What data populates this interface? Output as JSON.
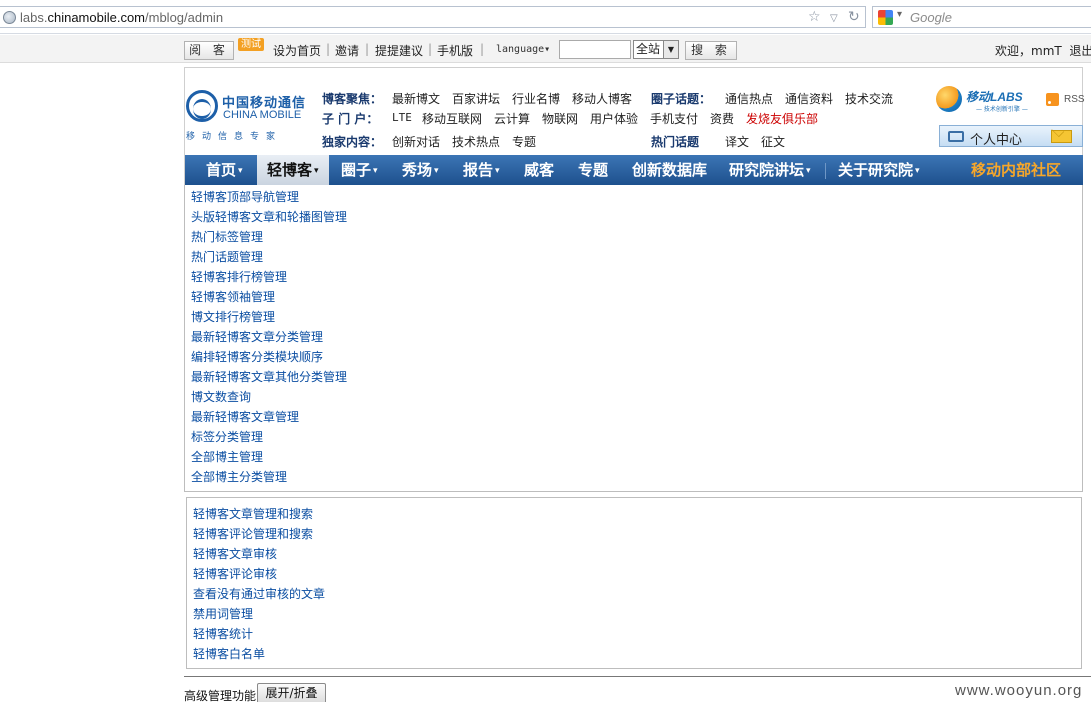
{
  "browser": {
    "url_prefix": "labs.",
    "url_domain": "chinamobile.com",
    "url_path": "/mblog/admin",
    "search_placeholder": "Google"
  },
  "topbar": {
    "read_button": "阅 客",
    "test_badge": "测试",
    "links": [
      "设为首页",
      "邀请",
      "提提建议",
      "手机版"
    ],
    "language": "language",
    "search_value": "",
    "scope": "全站",
    "search_button": "搜 索",
    "welcome": "欢迎，mmT",
    "logout": "退出"
  },
  "header": {
    "logo_cn": "中国移动通信",
    "logo_en": "CHINA MOBILE",
    "logo_sub": "移动信息专家",
    "row1_head": "博客聚焦：",
    "row1_links": [
      "最新博文",
      "百家讲坛",
      "行业名博",
      "移动人博客"
    ],
    "circle_head": "圈子话题：",
    "circle_links": [
      "通信热点",
      "通信资料",
      "技术交流"
    ],
    "row2_head": "子 门 户：",
    "row2_links": [
      "LTE",
      "移动互联网",
      "云计算",
      "物联网",
      "用户体验",
      "手机支付",
      "资费",
      "发烧友俱乐部"
    ],
    "row3_head": "独家内容：",
    "row3_links": [
      "创新对话",
      "技术热点",
      "专题"
    ],
    "hot_head": "热门话题",
    "hot_links": [
      "译文",
      "征文"
    ],
    "labs_name": "移动LABS",
    "labs_tag": "— 技术创新引擎 —",
    "rss": "RSS",
    "personal_center": "个人中心"
  },
  "nav": {
    "items": [
      {
        "label": "首页",
        "caret": "▾"
      },
      {
        "label": "轻博客",
        "caret": "▾",
        "active": true
      },
      {
        "label": "圈子",
        "caret": "▾"
      },
      {
        "label": "秀场",
        "caret": "▾"
      },
      {
        "label": "报告",
        "caret": "▾"
      },
      {
        "label": "威客",
        "caret": ""
      },
      {
        "label": "专题",
        "caret": ""
      },
      {
        "label": "创新数据库",
        "caret": ""
      },
      {
        "label": "研究院讲坛",
        "caret": "▾"
      },
      {
        "label": "关于研究院",
        "caret": "▾"
      },
      {
        "label": "移动内部社区",
        "caret": ""
      }
    ]
  },
  "menu1": [
    "轻博客顶部导航管理",
    "头版轻博客文章和轮播图管理",
    "热门标签管理",
    "热门话题管理",
    "轻博客排行榜管理",
    "轻博客领袖管理",
    "博文排行榜管理",
    "最新轻博客文章分类管理",
    "编排轻博客分类模块顺序",
    "最新轻博客文章其他分类管理",
    "博文数查询",
    "最新轻博客文章管理",
    "标签分类管理",
    "全部博主管理",
    "全部博主分类管理"
  ],
  "menu2": [
    "轻博客文章管理和搜索",
    "轻博客评论管理和搜索",
    "轻博客文章审核",
    "轻博客评论审核",
    "查看没有通过审核的文章",
    "禁用词管理",
    "轻博客统计",
    "轻博客白名单"
  ],
  "footer": {
    "advanced_label": "高级管理功能",
    "toggle_button": "展开/折叠",
    "watermark": "www.wooyun.org"
  }
}
